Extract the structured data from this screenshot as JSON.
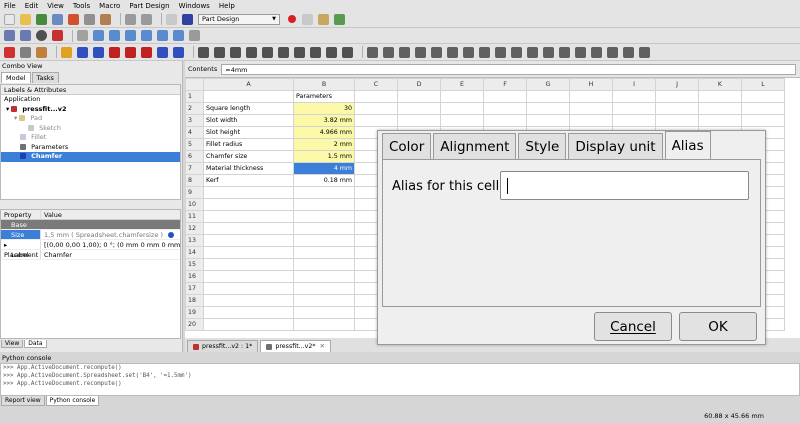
{
  "menu": [
    "File",
    "Edit",
    "View",
    "Tools",
    "Macro",
    "Part Design",
    "Windows",
    "Help"
  ],
  "toolbar": {
    "workbench": "Part Design"
  },
  "combo": {
    "title": "Combo View",
    "tabs": [
      "Model",
      "Tasks"
    ],
    "tree_header": "Labels & Attributes",
    "tree": [
      {
        "label": "Application"
      },
      {
        "label": "pressfit...v2"
      },
      {
        "label": "Pad"
      },
      {
        "label": "Sketch"
      },
      {
        "label": "Fillet"
      },
      {
        "label": "Parameters"
      },
      {
        "label": "Chamfer"
      }
    ],
    "prop_header": [
      "Property",
      "Value"
    ],
    "props": [
      {
        "p": "Base",
        "v": ""
      },
      {
        "p": "Size",
        "v": "1,5 mm  ( Spreadsheet.chamfersize )"
      },
      {
        "p": "Placement",
        "v": "[(0,00 0,00 1,00); 0 °; (0 mm  0 mm  0 mm)]"
      },
      {
        "p": "Label",
        "v": "Chamfer"
      }
    ],
    "view_tabs": [
      "View",
      "Data"
    ]
  },
  "sheet": {
    "contents_label": "Contents",
    "contents_value": "=4mm",
    "columns": [
      "A",
      "B",
      "C",
      "D",
      "E",
      "F",
      "G",
      "H",
      "I",
      "J",
      "K",
      "L"
    ],
    "rows": [
      {
        "n": "1",
        "a": "",
        "b": "Parameters"
      },
      {
        "n": "2",
        "a": "Square length",
        "b": "30"
      },
      {
        "n": "3",
        "a": "Slot width",
        "b": "3.82 mm"
      },
      {
        "n": "4",
        "a": "Slot height",
        "b": "4.966 mm"
      },
      {
        "n": "5",
        "a": "Fillet radius",
        "b": "2 mm"
      },
      {
        "n": "6",
        "a": "Chamfer size",
        "b": "1.5 mm"
      },
      {
        "n": "7",
        "a": "Material thickness",
        "b": "4 mm"
      },
      {
        "n": "8",
        "a": "Kerf",
        "b": "0.18 mm"
      },
      {
        "n": "9",
        "a": "",
        "b": ""
      },
      {
        "n": "10",
        "a": "",
        "b": ""
      },
      {
        "n": "11",
        "a": "",
        "b": ""
      },
      {
        "n": "12",
        "a": "",
        "b": ""
      },
      {
        "n": "13",
        "a": "",
        "b": ""
      },
      {
        "n": "14",
        "a": "",
        "b": ""
      },
      {
        "n": "15",
        "a": "",
        "b": ""
      },
      {
        "n": "16",
        "a": "",
        "b": ""
      },
      {
        "n": "17",
        "a": "",
        "b": ""
      },
      {
        "n": "18",
        "a": "",
        "b": ""
      },
      {
        "n": "19",
        "a": "",
        "b": ""
      },
      {
        "n": "20",
        "a": "",
        "b": ""
      }
    ],
    "doc_tabs": [
      "pressfit...v2 : 1*",
      "pressfit...v2*"
    ]
  },
  "dialog": {
    "tabs": [
      "Color",
      "Alignment",
      "Style",
      "Display unit",
      "Alias"
    ],
    "alias_label": "Alias for this cell",
    "alias_value": "",
    "cancel": "Cancel",
    "ok": "OK"
  },
  "python": {
    "title": "Python console",
    "lines": [
      ">>> App.ActiveDocument.recompute()",
      ">>> App.ActiveDocument.Spreadsheet.set('B4', '=1.5mm')",
      ">>> App.ActiveDocument.recompute()"
    ],
    "tabs": [
      "Report view",
      "Python console"
    ]
  },
  "status": "60.88 x 45.66 mm",
  "colors": {
    "selection": "#3c7fd8",
    "highlight_cell": "#fbf8a8",
    "record": "#d42020"
  }
}
